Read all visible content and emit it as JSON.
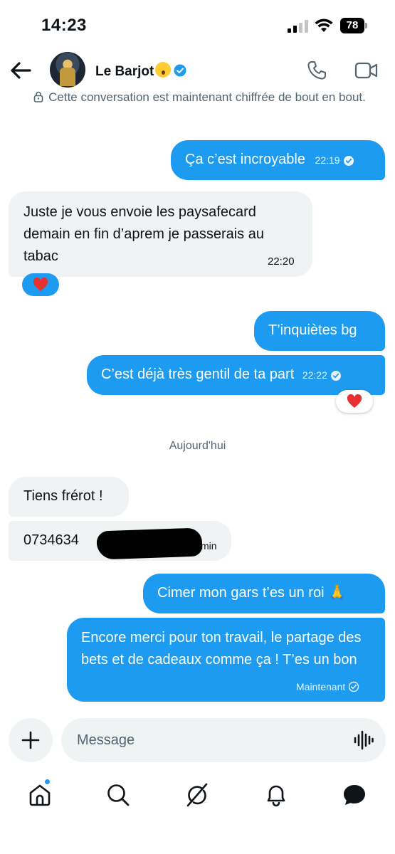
{
  "status_bar": {
    "time": "14:23",
    "battery": "78"
  },
  "header": {
    "contact_name": "Le Barjot",
    "encryption_notice": "Cette conversation est maintenant chiffrée de bout en bout."
  },
  "messages": [
    {
      "direction": "out",
      "text": "Ça c’est incroyable",
      "time": "22:19"
    },
    {
      "direction": "in",
      "text": "Juste je vous envoie les paysafecard demain en fin d’aprem je passerais au tabac",
      "time": "22:20",
      "reaction": "❤️"
    },
    {
      "direction": "out",
      "text": "T’inquiètes bg"
    },
    {
      "direction": "out",
      "text": "C’est déjà très gentil de ta part",
      "time": "22:22",
      "reaction": "❤️"
    },
    {
      "direction": "in",
      "text": "Tiens frérot !"
    },
    {
      "direction": "in",
      "text": "0734634",
      "time": "min"
    },
    {
      "direction": "out",
      "text": "Cimer mon gars t’es un roi 🙏"
    },
    {
      "direction": "out",
      "text": "Encore merci pour ton travail, le partage des bets et de cadeaux comme ça ! T’es un bon",
      "time": "Maintenant"
    }
  ],
  "date_separator": "Aujourd'hui",
  "composer": {
    "placeholder": "Message"
  },
  "colors": {
    "accent": "#1d9bf0",
    "incoming_bubble": "#eff3f4",
    "secondary_text": "#536471"
  },
  "icons": {
    "header": [
      "back-arrow-icon",
      "phone-icon",
      "video-camera-icon",
      "verified-badge-icon",
      "lock-icon"
    ],
    "nav": [
      "home-icon",
      "search-icon",
      "grok-icon",
      "notifications-icon",
      "messages-icon"
    ]
  }
}
